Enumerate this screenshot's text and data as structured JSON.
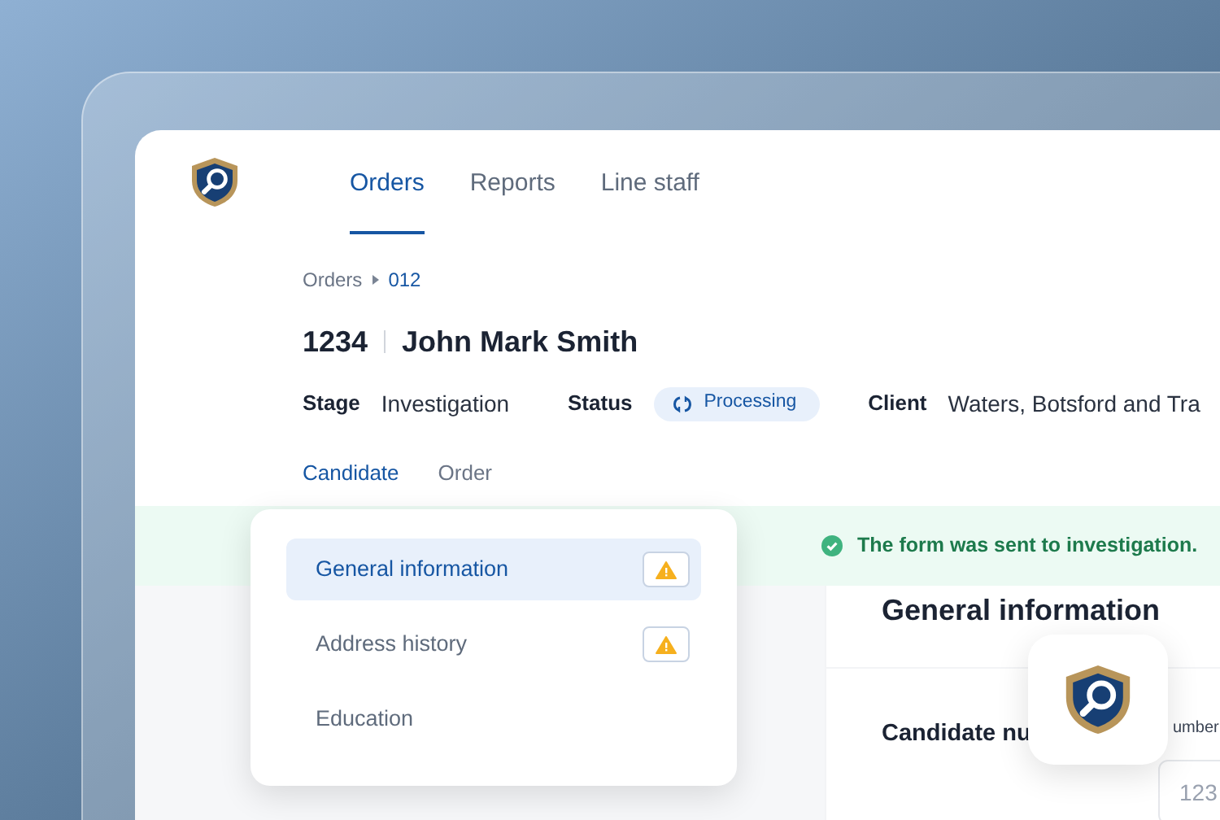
{
  "nav": {
    "tabs": [
      {
        "label": "Orders",
        "selected": true
      },
      {
        "label": "Reports",
        "selected": false
      },
      {
        "label": "Line staff",
        "selected": false
      }
    ]
  },
  "breadcrumb": [
    "Orders",
    "012"
  ],
  "header": {
    "number": "1234",
    "name": "John Mark Smith"
  },
  "meta": [
    {
      "label": "Stage",
      "value": "Investigation",
      "kind": "text"
    },
    {
      "label": "Status",
      "value": "Processing",
      "kind": "pill"
    },
    {
      "label": "Client",
      "value": "Waters, Botsford and Tra",
      "kind": "text"
    }
  ],
  "subtabs": [
    {
      "label": "Candidate",
      "selected": true
    },
    {
      "label": "Order",
      "selected": false
    }
  ],
  "banner": {
    "text": "The form was sent to investigation."
  },
  "sections_menu": [
    {
      "label": "General information",
      "selected": true,
      "warning": true
    },
    {
      "label": "Address history",
      "selected": false,
      "warning": true
    },
    {
      "label": "Education",
      "selected": false,
      "warning": false
    }
  ],
  "form": {
    "title": "General information",
    "field_label": "Candidate nu",
    "input_label": "umber",
    "input_value": "123"
  }
}
